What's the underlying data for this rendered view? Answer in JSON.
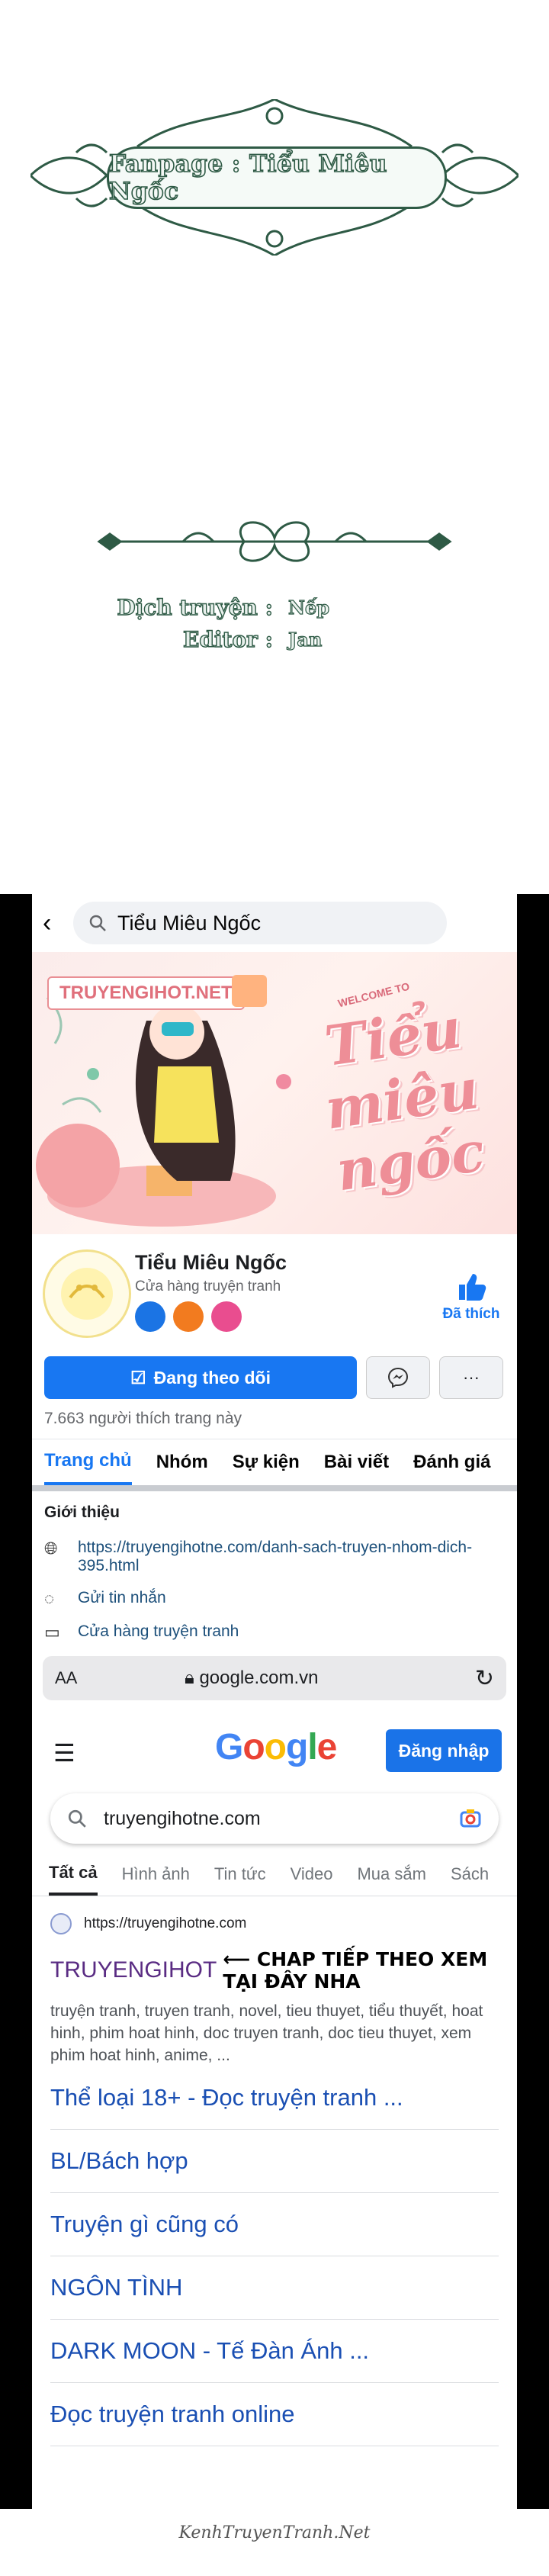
{
  "credits": {
    "fanpage_banner": "Fanpage : Tiểu Miêu Ngốc",
    "translator_label": "Dịch truyện :",
    "translator_name": "Nếp",
    "editor_label": "Editor :",
    "editor_name": "Jan"
  },
  "facebook": {
    "search_query": "Tiểu Miêu Ngốc",
    "cover_site": "TRUYENGIHOT.NET",
    "cover_welcome": "WELCOME TO",
    "cover_title": "Tiểu miêu ngốc",
    "page_name": "Tiểu Miêu Ngốc",
    "page_category": "Cửa hàng truyện tranh",
    "like_label": "Đã thích",
    "follow_label": "Đang theo dõi",
    "more_label": "···",
    "like_count": "7.663 người thích trang này",
    "tabs": [
      "Trang chủ",
      "Nhóm",
      "Sự kiện",
      "Bài viết",
      "Đánh giá"
    ],
    "intro_title": "Giới thiệu",
    "intro_link": "https://truyengihotne.com/danh-sach-truyen-nhom-dich-395.html",
    "intro_message": "Gửi tin nhắn",
    "intro_shop": "Cửa hàng truyện tranh"
  },
  "browser": {
    "aa": "AA",
    "domain": "google.com.vn"
  },
  "google": {
    "signin": "Đăng nhập",
    "query": "truyengihotne.com",
    "tabs": [
      "Tất cả",
      "Hình ảnh",
      "Tin tức",
      "Video",
      "Mua sắm",
      "Sách"
    ],
    "result_url": "https://truyengihotne.com",
    "result_title": "TRUYENGIHOT",
    "result_annotation": "⟵ CHAP TIẾP THEO XEM TẠI ĐÂY NHA",
    "result_snippet": "truyện tranh, truyen tranh, novel, tieu thuyet, tiểu thuyết, hoat hinh, phim hoat hinh, doc truyen tranh, doc tieu thuyet, xem phim hoat hinh, anime, ...",
    "sublinks": [
      "Thể loại 18+ - Đọc truyện tranh ...",
      "BL/Bách hợp",
      "Truyện gì cũng có",
      "NGÔN TÌNH",
      "DARK MOON - Tế Đàn Ánh ...",
      "Đọc truyện tranh online"
    ]
  },
  "footer_signature": "KenhTruyenTranh.Net"
}
